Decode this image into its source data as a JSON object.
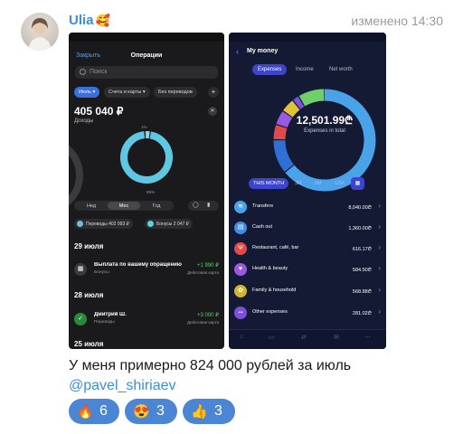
{
  "message": {
    "author": "Ulia",
    "author_emoji": "🥰",
    "status": "изменено 14:30",
    "text": "У меня примерно 824 000 рублей за июль",
    "mention": "@pavel_shiriaev",
    "reactions": [
      {
        "emoji": "🔥",
        "count": "6"
      },
      {
        "emoji": "😍",
        "count": "3"
      },
      {
        "emoji": "👍",
        "count": "3"
      }
    ]
  },
  "left_screen": {
    "close_label": "Закрыть",
    "title": "Операции",
    "search_placeholder": "Поиск",
    "filters": [
      "Июль ▾",
      "Счета и карты ▾",
      "Без переводов",
      "+"
    ],
    "total_amount": "405 040 ₽",
    "total_label": "Доходы",
    "donut": {
      "percent_top": "1%",
      "percent_bottom": "99%",
      "colors": [
        "#8fd8ea",
        "#5ec8e2",
        "#2b2b2d"
      ]
    },
    "period_tabs": [
      "Нед",
      "Мес",
      "Год"
    ],
    "pills": [
      {
        "label": "Переводы 402 993 ₽",
        "color": "#6bbfe0"
      },
      {
        "label": "Бонусы 2 047 ₽",
        "color": "#56d4e8"
      }
    ],
    "groups": [
      {
        "date": "29 июля",
        "items": [
          {
            "title": "Выплата по вашему обращению",
            "category": "Бонусы",
            "amount": "+1 990 ₽",
            "card": "Дебетовая карта",
            "icon": "gift-icon",
            "icon_bg": "#3a3a3c"
          }
        ]
      },
      {
        "date": "28 июля",
        "items": [
          {
            "title": "Дмитрий Ш.",
            "category": "Переводы",
            "amount": "+3 000 ₽",
            "card": "Дебетовая карта",
            "icon": "check-icon",
            "icon_bg": "#2a8a3a"
          }
        ]
      },
      {
        "date": "25 июля",
        "items": []
      }
    ]
  },
  "right_screen": {
    "title": "My money",
    "tabs": [
      "Expenses",
      "Income",
      "Net worth"
    ],
    "total_amount": "12,501.99₾",
    "total_label": "Expenses in total",
    "donut_segments": [
      {
        "label": "Transfers",
        "color": "#4aa3e8",
        "share": 64.3
      },
      {
        "label": "Cash out",
        "color": "#2f6fd6",
        "share": 10.9
      },
      {
        "label": "Restaurant, café, bar",
        "color": "#e24a4a",
        "share": 4.9
      },
      {
        "label": "Health & beauty",
        "color": "#9b59e0",
        "share": 4.7
      },
      {
        "label": "Family & household",
        "color": "#e0c23a",
        "share": 4.5
      },
      {
        "label": "Other expenses",
        "color": "#7b4fe0",
        "share": 2.2
      },
      {
        "label": "Other",
        "color": "#6fd06a",
        "share": 8.5
      }
    ],
    "periods": [
      "THIS MONTH",
      "3M",
      "6M",
      "12M"
    ],
    "categories": [
      {
        "name": "Transfers",
        "amount": "8,040.00₾",
        "color": "#4aa3e8",
        "icon": "≋"
      },
      {
        "name": "Cash out",
        "amount": "1,360.00₾",
        "color": "#3f8fe8",
        "icon": "▤"
      },
      {
        "name": "Restaurant, café, bar",
        "amount": "616.17₾",
        "color": "#e24a4a",
        "icon": "Ψ"
      },
      {
        "name": "Health & beauty",
        "amount": "584.50₾",
        "color": "#9b59e0",
        "icon": "♥"
      },
      {
        "name": "Family & household",
        "amount": "568.88₾",
        "color": "#d4b42a",
        "icon": "✿"
      },
      {
        "name": "Other expenses",
        "amount": "281.02₾",
        "color": "#7b4fe0",
        "icon": "•••"
      }
    ]
  }
}
